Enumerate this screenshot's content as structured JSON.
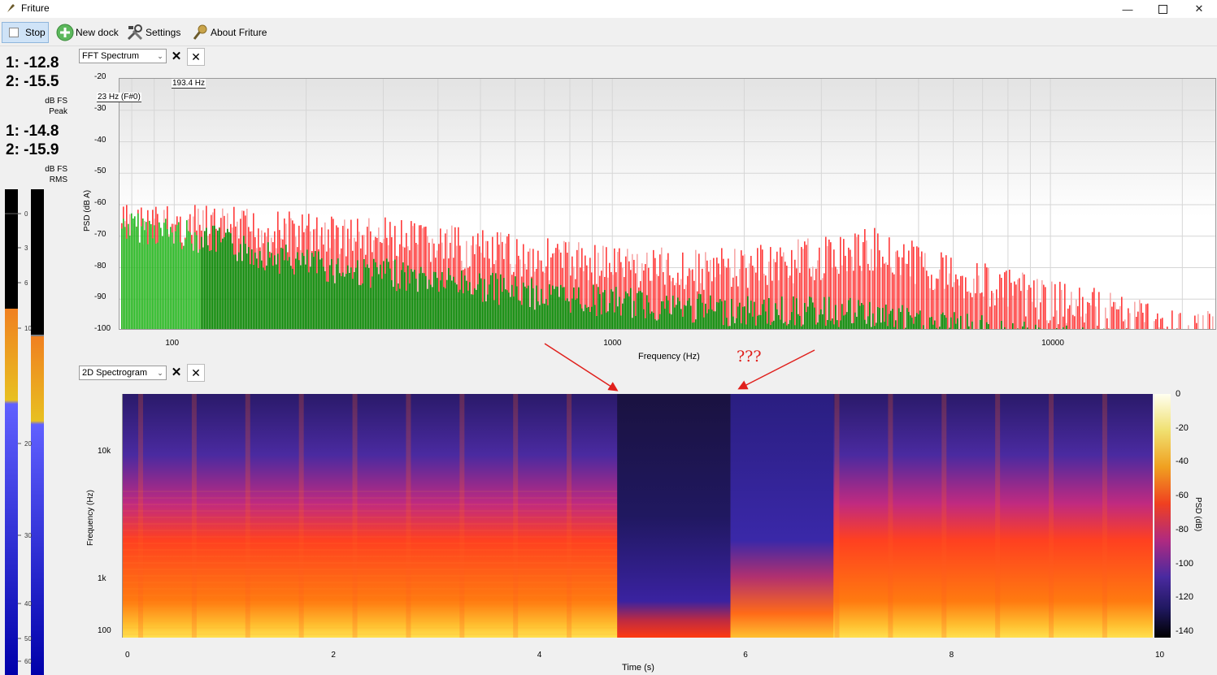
{
  "app": {
    "title": "Friture"
  },
  "toolbar": {
    "stop": "Stop",
    "new_dock": "New dock",
    "settings": "Settings",
    "about": "About Friture"
  },
  "levels": {
    "peak_1": "1: -12.8",
    "peak_2": "2: -15.5",
    "peak_unit": "dB FS",
    "peak_label": "Peak",
    "rms_1": "1: -14.8",
    "rms_2": "2: -15.9",
    "rms_unit": "dB FS",
    "rms_label": "RMS",
    "meter_ticks": [
      "0",
      "3",
      "6",
      "10",
      "20",
      "30",
      "40",
      "50",
      "60"
    ],
    "meter_values": {
      "ch1_peak_db": -12.8,
      "ch2_peak_db": -15.5,
      "ch1_rms_db": -14.8,
      "ch2_rms_db": -15.9
    }
  },
  "spectrum_dock": {
    "selector": "FFT Spectrum",
    "ylabel": "PSD (dB A)",
    "xlabel": "Frequency (Hz)",
    "yticks": [
      "-20",
      "-30",
      "-40",
      "-50",
      "-60",
      "-70",
      "-80",
      "-90",
      "-100"
    ],
    "xticks": [
      "100",
      "1000",
      "10000"
    ],
    "marker_peak": "193.4 Hz",
    "marker_note": "23 Hz (F#0)"
  },
  "spectrogram_dock": {
    "selector": "2D Spectrogram",
    "ylabel": "Frequency (Hz)",
    "xlabel": "Time (s)",
    "yticks": [
      "10k",
      "1k",
      "100"
    ],
    "xticks": [
      "0",
      "2",
      "4",
      "6",
      "8",
      "10"
    ],
    "colorbar_label": "PSD (dB)",
    "colorbar_ticks": [
      "0",
      "-20",
      "-40",
      "-60",
      "-80",
      "-100",
      "-120",
      "-140"
    ]
  },
  "annotation": {
    "text": "???",
    "color": "#e0201c"
  },
  "chart_data": [
    {
      "type": "bar",
      "title": "",
      "xlabel": "Frequency (Hz)",
      "ylabel": "PSD (dB A)",
      "xscale": "log",
      "xlim": [
        75,
        24000
      ],
      "ylim": [
        -100,
        -20
      ],
      "series": [
        {
          "name": "",
          "color": "#ff3a3a",
          "x": [
            80,
            100,
            120,
            150,
            200,
            250,
            300,
            400,
            500,
            700,
            1000,
            1500,
            2000,
            3000,
            4000,
            5000,
            7000,
            10000,
            15000,
            20000
          ],
          "values": [
            -59,
            -60,
            -60,
            -61,
            -62,
            -63,
            -64,
            -66,
            -68,
            -70,
            -72,
            -74,
            -73,
            -70,
            -67,
            -72,
            -78,
            -84,
            -88,
            -93
          ]
        },
        {
          "name": "",
          "color": "#008800",
          "x": [
            80,
            100,
            120,
            150,
            200,
            250,
            300,
            400,
            500,
            700,
            1000,
            1500,
            2000,
            3000,
            4000,
            5000,
            7000,
            10000,
            15000,
            20000
          ],
          "values": [
            -62,
            -64,
            -66,
            -70,
            -74,
            -76,
            -77,
            -79,
            -81,
            -84,
            -86,
            -88,
            -89,
            -89,
            -90,
            -93,
            -95,
            -98,
            -100,
            -100
          ]
        }
      ]
    },
    {
      "type": "heatmap",
      "title": "",
      "xlabel": "Time (s)",
      "ylabel": "Frequency (Hz)",
      "xlim": [
        0,
        10
      ],
      "yscale": "log",
      "colorbar": {
        "label": "PSD (dB)",
        "range": [
          -140,
          0
        ]
      },
      "dark_segments": [
        {
          "start": 4.8,
          "end": 5.9
        },
        {
          "start": 5.9,
          "end": 6.9
        }
      ]
    }
  ]
}
